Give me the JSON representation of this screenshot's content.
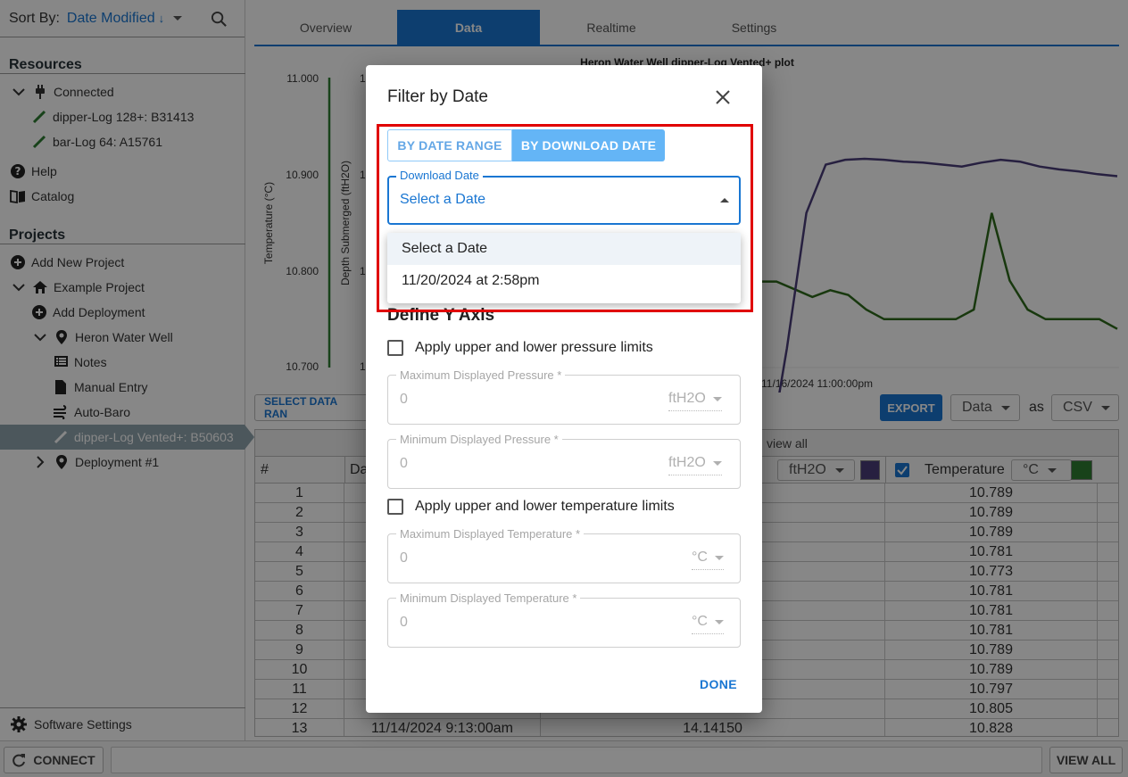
{
  "sidebar": {
    "sort_label": "Sort By:",
    "sort_value": "Date Modified",
    "sort_dir": "↓",
    "resources_title": "Resources",
    "resources": [
      {
        "label": "Connected",
        "icon": "plug-icon"
      },
      {
        "label": "dipper-Log 128+: B31413",
        "icon": "pencil-icon"
      },
      {
        "label": "bar-Log 64: A15761",
        "icon": "pencil-icon"
      }
    ],
    "help_label": "Help",
    "catalog_label": "Catalog",
    "projects_title": "Projects",
    "add_new_project": "Add New Project",
    "example_project": "Example Project",
    "add_deployment": "Add Deployment",
    "heron_water_well": "Heron Water Well",
    "notes": "Notes",
    "manual_entry": "Manual Entry",
    "auto_baro": "Auto-Baro",
    "selected_item": "dipper-Log Vented+: B50603",
    "deployment_1": "Deployment #1",
    "software_settings": "Software Settings"
  },
  "tabs": [
    "Overview",
    "Data",
    "Realtime",
    "Settings"
  ],
  "active_tab": "Data",
  "chart": {
    "title": "Heron Water Well dipper-Log Vented+ plot",
    "ylabel_left": "Temperature (°C)",
    "ylabel_right": "Depth Submerged (ftH2O)",
    "yticks_left": [
      "11.000",
      "10.900",
      "10.800",
      "10.700"
    ],
    "yticks_right_partial": [
      "1",
      "1",
      "1",
      "1"
    ],
    "x_tick_label": "11/16/2024 11:00:00pm",
    "colors": {
      "depth": "#4a3d7a",
      "temperature": "#2e6b1c",
      "axis_left": "#2e7d32"
    }
  },
  "chart_data": {
    "type": "line",
    "title": "Heron Water Well dipper-Log Vented+ plot",
    "ylabel": "Temperature (°C)",
    "y2label": "Depth Submerged (ftH2O)",
    "ylim": [
      10.7,
      11.0
    ],
    "series": [
      {
        "name": "Temperature",
        "color": "#2e6b1c",
        "values": [
          10.789,
          10.789,
          10.781,
          10.773,
          10.78,
          10.775,
          10.76,
          10.75,
          10.75,
          10.75,
          10.75,
          10.75,
          10.76,
          10.86,
          10.79,
          10.76,
          10.75,
          10.75,
          10.75,
          10.75,
          10.74
        ]
      },
      {
        "name": "Depth Submerged",
        "color": "#4a3d7a",
        "values": [
          10.6,
          10.72,
          10.86,
          10.91,
          10.915,
          10.916,
          10.915,
          10.913,
          10.912,
          10.91,
          10.908,
          10.912,
          10.915,
          10.913,
          10.908,
          10.905,
          10.903,
          10.9,
          10.898
        ]
      }
    ]
  },
  "toolbar": {
    "select_data_range": "SELECT DATA RAN",
    "export": "EXPORT",
    "data_select": "Data",
    "as_label": "as",
    "format_select": "CSV"
  },
  "table": {
    "view_all": "view all",
    "col_index": "#",
    "col_date": "Da",
    "unit_depth": "ftH2O",
    "depth_color": "#4a3d7a",
    "temp_label": "Temperature",
    "unit_temp": "°C",
    "temp_color": "#2e7d32",
    "rows": [
      {
        "n": "1",
        "date": "",
        "depth": "",
        "temp": "10.789"
      },
      {
        "n": "2",
        "date": "",
        "depth": "",
        "temp": "10.789"
      },
      {
        "n": "3",
        "date": "",
        "depth": "",
        "temp": "10.789"
      },
      {
        "n": "4",
        "date": "",
        "depth": "",
        "temp": "10.781"
      },
      {
        "n": "5",
        "date": "",
        "depth": "",
        "temp": "10.773"
      },
      {
        "n": "6",
        "date": "",
        "depth": "",
        "temp": "10.781"
      },
      {
        "n": "7",
        "date": "",
        "depth": "",
        "temp": "10.781"
      },
      {
        "n": "8",
        "date": "",
        "depth": "",
        "temp": "10.781"
      },
      {
        "n": "9",
        "date": "",
        "depth": "",
        "temp": "10.789"
      },
      {
        "n": "10",
        "date": "",
        "depth": "",
        "temp": "10.789"
      },
      {
        "n": "11",
        "date": "",
        "depth": "",
        "temp": "10.797"
      },
      {
        "n": "12",
        "date": "",
        "depth": "",
        "temp": "10.805"
      },
      {
        "n": "13",
        "date": "11/14/2024 9:13:00am",
        "depth": "14.14150",
        "temp": "10.828"
      }
    ]
  },
  "statusbar": {
    "connect": "CONNECT",
    "view_all": "VIEW ALL"
  },
  "dialog": {
    "title": "Filter by Date",
    "by_date_range": "BY DATE RANGE",
    "by_download_date": "BY DOWNLOAD DATE",
    "download_date_label": "Download Date",
    "download_date_value": "Select a Date",
    "options": [
      "Select a Date",
      "11/20/2024 at 2:58pm"
    ],
    "define_y_axis": "Define Y Axis",
    "pressure_check": "Apply upper and lower pressure limits",
    "max_pressure_label": "Maximum Displayed Pressure *",
    "min_pressure_label": "Minimum Displayed Pressure *",
    "pressure_value": "0",
    "pressure_unit": "ftH2O",
    "temp_check": "Apply upper and lower temperature limits",
    "max_temp_label": "Maximum Displayed Temperature *",
    "min_temp_label": "Minimum Displayed Temperature *",
    "temp_value": "0",
    "temp_unit": "°C",
    "done": "DONE"
  }
}
